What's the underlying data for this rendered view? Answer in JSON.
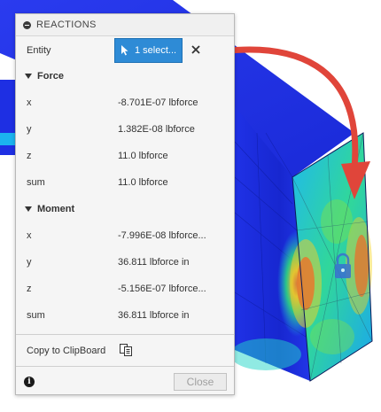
{
  "panel": {
    "title": "REACTIONS",
    "entity": {
      "label": "Entity",
      "button_label": "1 select..."
    },
    "force": {
      "header": "Force",
      "rows": [
        {
          "label": "x",
          "value": "-8.701E-07 lbforce"
        },
        {
          "label": "y",
          "value": "1.382E-08 lbforce"
        },
        {
          "label": "z",
          "value": "11.0 lbforce"
        },
        {
          "label": "sum",
          "value": "11.0 lbforce"
        }
      ]
    },
    "moment": {
      "header": "Moment",
      "rows": [
        {
          "label": "x",
          "value": "-7.996E-08 lbforce..."
        },
        {
          "label": "y",
          "value": "36.811 lbforce in"
        },
        {
          "label": "z",
          "value": "-5.156E-07 lbforce..."
        },
        {
          "label": "sum",
          "value": "36.811 lbforce in"
        }
      ]
    },
    "copy_label": "Copy to ClipBoard",
    "close_label": "Close"
  },
  "colors": {
    "accent": "#2e8bd6",
    "arrow": "#e0453a",
    "model_blue": "#1d2fe0"
  },
  "icons": [
    "collapse-icon",
    "cursor-icon",
    "close-icon",
    "triangle-down-icon",
    "clipboard-icon",
    "info-icon",
    "lock-icon"
  ]
}
